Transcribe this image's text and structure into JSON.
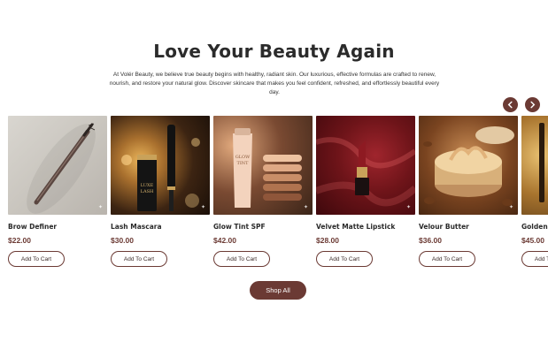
{
  "section": {
    "title": "Love Your Beauty Again",
    "intro": "At Volér Beauty, we believe true beauty begins with healthy, radiant skin. Our luxurious, effective formulas are crafted to renew, nourish, and restore your natural glow. Discover skincare that makes you feel confident, refreshed, and effortlessly beautiful every day."
  },
  "carousel": {
    "prev_icon": "chevron-left-icon",
    "next_icon": "chevron-right-icon",
    "add_to_cart_label": "Add To Cart",
    "products": [
      {
        "name": "Brow Definer",
        "price": "$22.00",
        "image": "brow-pencil"
      },
      {
        "name": "Lash Mascara",
        "price": "$30.00",
        "image": "mascara",
        "image_text": "LUXE\nLASH"
      },
      {
        "name": "Glow Tint SPF",
        "price": "$42.00",
        "image": "tint-tube",
        "image_text": "GLOW\nTINT"
      },
      {
        "name": "Velvet Matte Lipstick",
        "price": "$28.00",
        "image": "lipstick"
      },
      {
        "name": "Velour Butter",
        "price": "$36.00",
        "image": "butter-jar"
      },
      {
        "name": "Golden",
        "price": "$45.00",
        "image": "golden-partial"
      }
    ]
  },
  "shop_all_label": "Shop All",
  "colors": {
    "accent": "#6b3a34",
    "title": "#2b2b2b",
    "background": "#ffffff"
  }
}
